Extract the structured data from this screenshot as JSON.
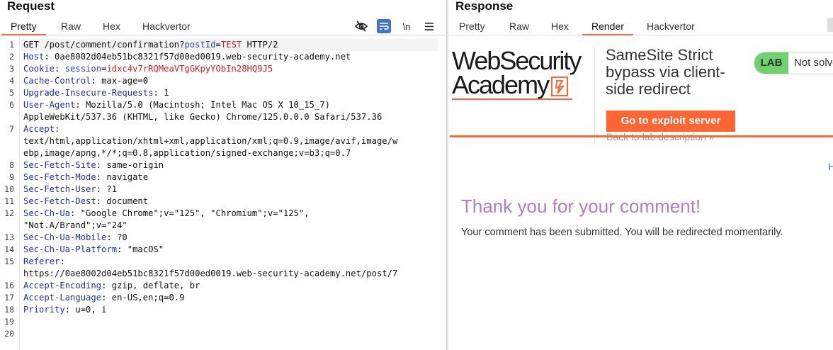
{
  "request": {
    "title": "Request",
    "tabs": [
      "Pretty",
      "Raw",
      "Hex",
      "Hackvertor"
    ],
    "active_tab": "Pretty",
    "tools": {
      "hide_icon": "eye-slash-icon",
      "wrap_icon": "wrap-lines-icon",
      "newline_label": "\\n",
      "menu_icon": "hamburger-menu-icon"
    },
    "line_numbers": [
      "1",
      "2",
      "3",
      "4",
      "5",
      "6",
      "",
      "7",
      "",
      "",
      "8",
      "9",
      "10",
      "11",
      "12",
      "",
      "13",
      "14",
      "15",
      "",
      "16",
      "17",
      "18",
      "19",
      "20"
    ],
    "lines": {
      "l1_a": "GET /post/comment/confirmation?",
      "l1_param": "postId",
      "l1_eq": "=",
      "l1_val": "TEST",
      "l1_b": " HTTP/2",
      "l2_k": "Host",
      "l2_v": ": 0ae8002d04eb51bc8321f57d00ed0019.web-security-academy.net",
      "l3_k": "Cookie",
      "l3_sep": ": ",
      "l3_ck": "session",
      "l3_eq": "=",
      "l3_cv": "idxc4v7rRQMeaVTgGKpyYObIn28HQ9J5",
      "l4_k": "Cache-Control",
      "l4_v": ": max-age=0",
      "l5_k": "Upgrade-Insecure-Requests",
      "l5_v": ": 1",
      "l6_k": "User-Agent",
      "l6_v": ": Mozilla/5.0 (Macintosh; Intel Mac OS X 10_15_7)",
      "l6_c": "AppleWebKit/537.36 (KHTML, like Gecko) Chrome/125.0.0.0 Safari/537.36",
      "l7_k": "Accept",
      "l7_v": ":",
      "l7_c1": "text/html,application/xhtml+xml,application/xml;q=0.9,image/avif,image/w",
      "l7_c2": "ebp,image/apng,*/*;q=0.8,application/signed-exchange;v=b3;q=0.7",
      "l8_k": "Sec-Fetch-Site",
      "l8_v": ": same-origin",
      "l9_k": "Sec-Fetch-Mode",
      "l9_v": ": navigate",
      "l10_k": "Sec-Fetch-User",
      "l10_v": ": ?1",
      "l11_k": "Sec-Fetch-Dest",
      "l11_v": ": document",
      "l12_k": "Sec-Ch-Ua",
      "l12_v": ": \"Google Chrome\";v=\"125\", \"Chromium\";v=\"125\",",
      "l12_c": "\"Not.A/Brand\";v=\"24\"",
      "l13_k": "Sec-Ch-Ua-Mobile",
      "l13_v": ": ?0",
      "l14_k": "Sec-Ch-Ua-Platform",
      "l14_v": ": \"macOS\"",
      "l15_k": "Referer",
      "l15_v": ":",
      "l15_c": "https://0ae8002d04eb51bc8321f57d00ed0019.web-security-academy.net/post/7",
      "l16_k": "Accept-Encoding",
      "l16_v": ": gzip, deflate, br",
      "l17_k": "Accept-Language",
      "l17_v": ": en-US,en;q=0.9",
      "l18_k": "Priority",
      "l18_v": ": u=0, i"
    }
  },
  "response": {
    "title": "Response",
    "tabs": [
      "Pretty",
      "Raw",
      "Hex",
      "Render",
      "Hackvertor"
    ],
    "active_tab": "Render",
    "render": {
      "logo_line1": "WebSecurity",
      "logo_line2": "Academy",
      "lab_title": "SameSite Strict bypass via client-side redirect",
      "lab_badge": "LAB",
      "lab_status": "Not solved",
      "exploit_button": "Go to exploit server",
      "back_link": "Back to lab description »",
      "right_nav_partial": "H",
      "heading": "Thank you for your comment!",
      "message": "Your comment has been submitted. You will be redirected momentarily."
    }
  },
  "colors": {
    "accent_orange": "#ff6633",
    "header_key_blue": "#1e2fa0",
    "value_red": "#cc2222",
    "lab_green": "#70d16f",
    "heading_purple": "#b57bc9"
  }
}
